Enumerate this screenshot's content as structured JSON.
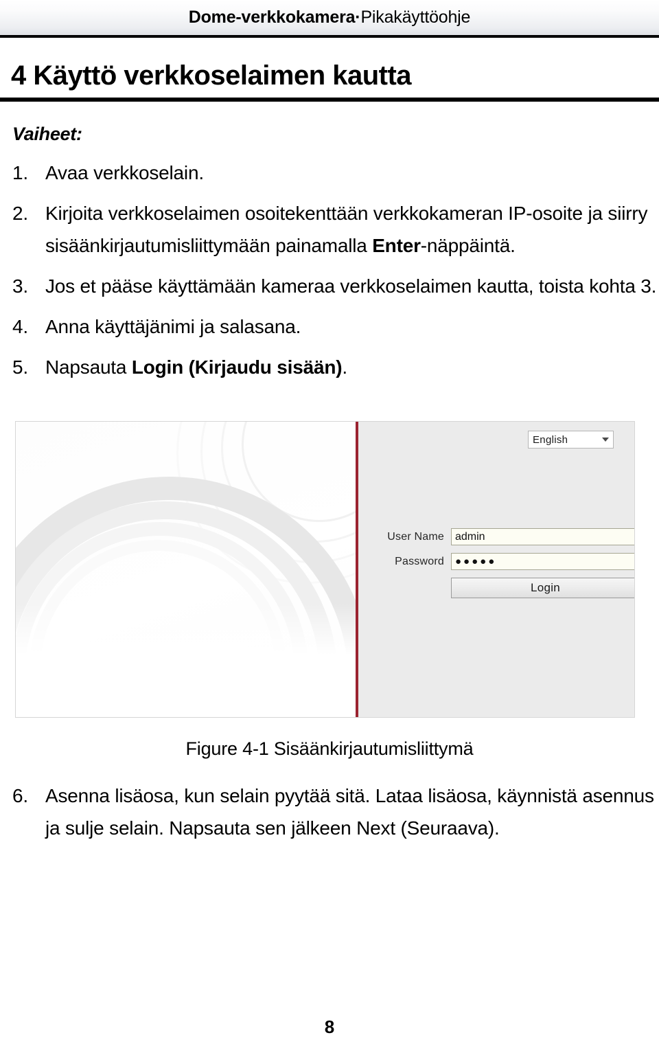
{
  "header": {
    "title_bold": "Dome-verkkokamera·",
    "title_regular": "Pikakäyttöohje"
  },
  "section": {
    "heading": "4 Käyttö verkkoselaimen kautta",
    "steps_label": "Vaiheet:"
  },
  "steps": [
    {
      "number": "1.",
      "text_before": "Avaa verkkoselain.",
      "bold": "",
      "text_after": ""
    },
    {
      "number": "2.",
      "text_before": "Kirjoita verkkoselaimen osoitekenttään verkkokameran IP-osoite ja siirry sisäänkirjautumisliittymään painamalla ",
      "bold": "Enter",
      "text_after": "-näppäintä."
    },
    {
      "number": "3.",
      "text_before": "Jos et pääse käyttämään kameraa verkkoselaimen kautta, toista kohta 3.",
      "bold": "",
      "text_after": ""
    },
    {
      "number": "4.",
      "text_before": "Anna käyttäjänimi ja salasana.",
      "bold": "",
      "text_after": ""
    },
    {
      "number": "5.",
      "text_before": "Napsauta ",
      "bold": "Login (Kirjaudu sisään)",
      "text_after": "."
    }
  ],
  "figure": {
    "caption": "Figure 4-1 Sisäänkirjautumisliittymä",
    "divider_color": "#9b2330",
    "panel_background": "#ebebeb",
    "language_select": {
      "value": "English",
      "caret_icon": "chevron-down-icon"
    },
    "form": {
      "username_label": "User Name",
      "username_value": "admin",
      "username_placeholder": "User Name",
      "password_label": "Password",
      "password_value": "●●●●●",
      "password_placeholder": "Password",
      "login_button": "Login"
    }
  },
  "steps_tail": [
    {
      "number": "6.",
      "text_before": "Asenna lisäosa, kun selain pyytää sitä. Lataa lisäosa, käynnistä asennus ja sulje selain. Napsauta sen jälkeen Next (Seuraava).",
      "bold": "",
      "text_after": ""
    }
  ],
  "footer": {
    "page_number": "8"
  }
}
